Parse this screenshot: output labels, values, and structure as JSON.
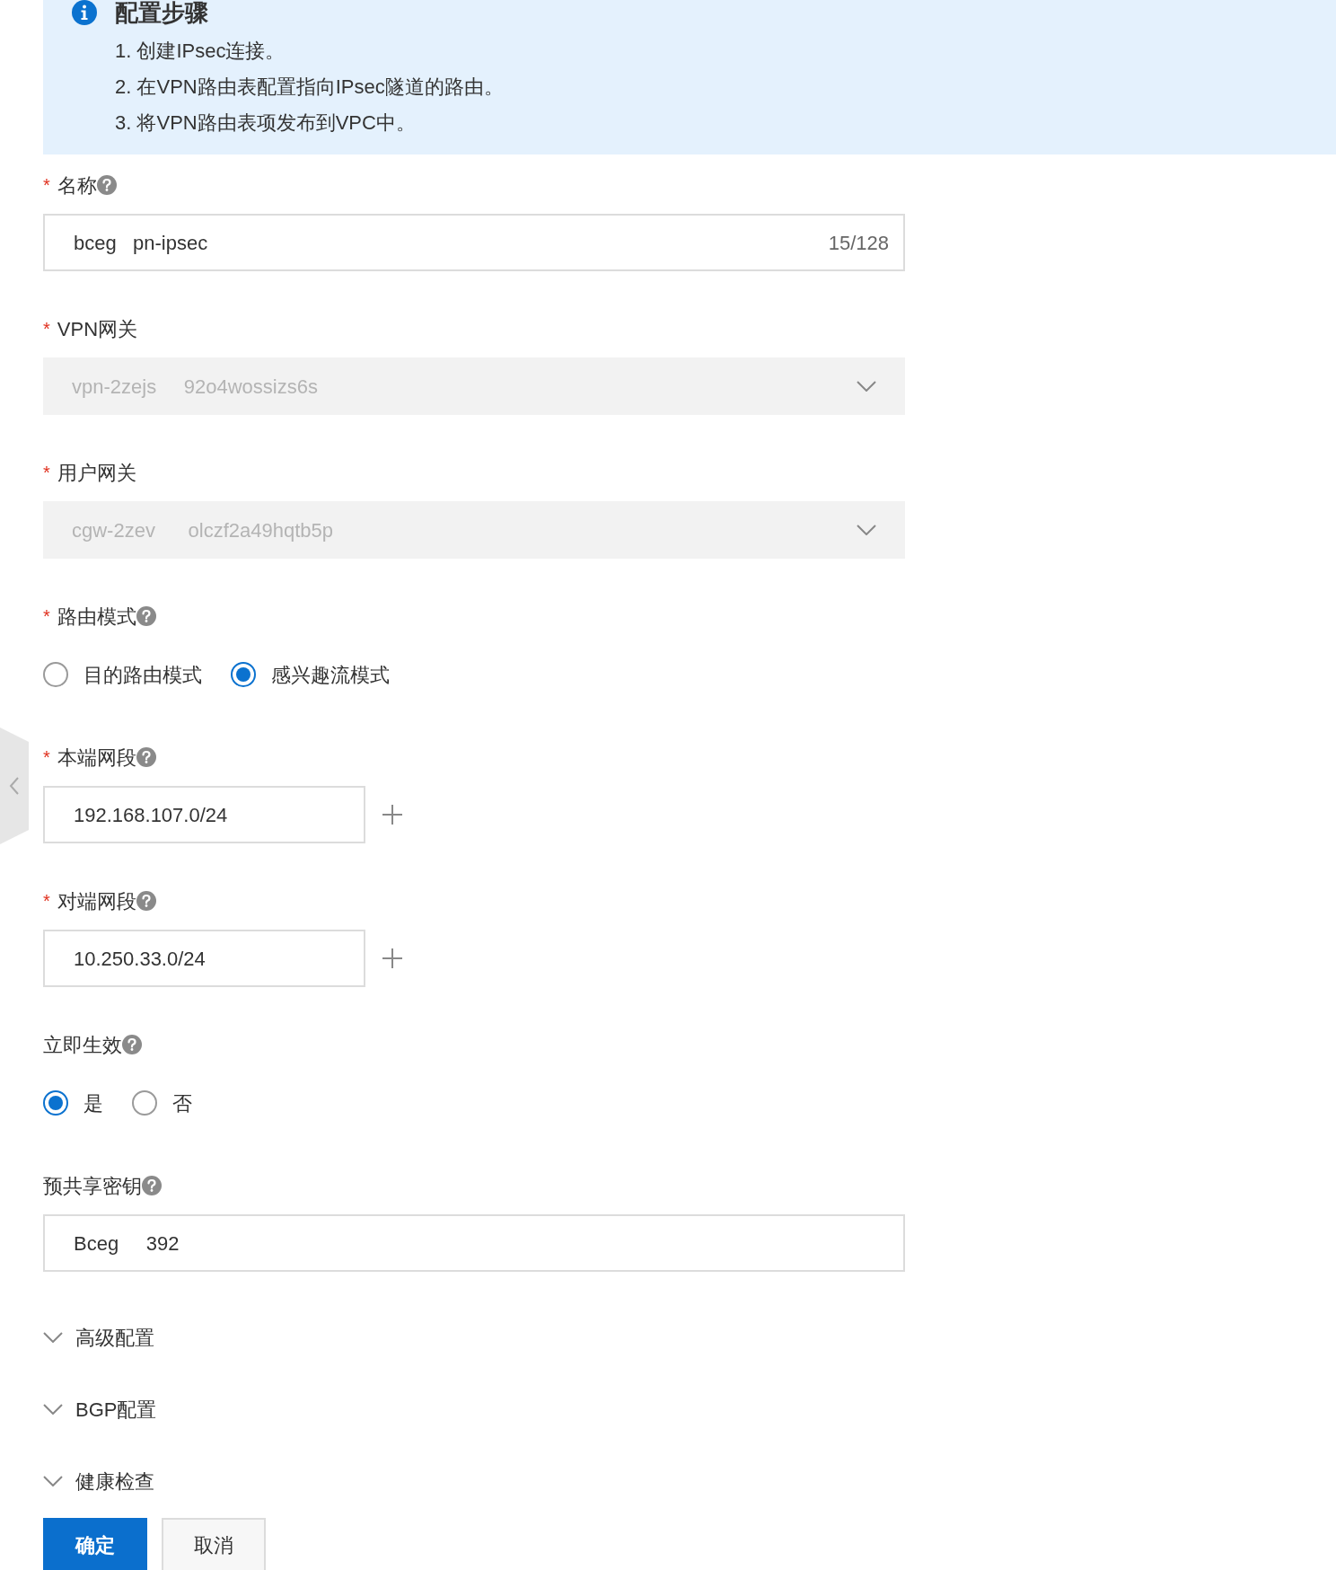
{
  "steps_panel": {
    "title": "配置步骤",
    "steps": [
      "1. 创建IPsec连接。",
      "2. 在VPN路由表配置指向IPsec隧道的路由。",
      "3. 将VPN路由表项发布到VPC中。"
    ]
  },
  "fields": [
    {
      "kind": "text",
      "label": "名称",
      "required_mark": "*",
      "help": true,
      "value": "bceg   pn-ipsec",
      "counter": "15/128"
    },
    {
      "kind": "select",
      "label": "VPN网关",
      "required_mark": "*",
      "help": false,
      "value": "vpn-2zejs     92o4wossizs6s",
      "disabled": true
    },
    {
      "kind": "select",
      "label": "用户网关",
      "required_mark": "*",
      "help": false,
      "value": "cgw-2zev      olczf2a49hqtb5p",
      "disabled": true
    },
    {
      "kind": "radio",
      "label": "路由模式",
      "required_mark": "*",
      "help": true,
      "options": [
        {
          "label": "目的路由模式",
          "selected": false
        },
        {
          "label": "感兴趣流模式",
          "selected": true
        }
      ]
    },
    {
      "kind": "cidr",
      "label": "本端网段",
      "required_mark": "*",
      "help": true,
      "value": "192.168.107.0/24"
    },
    {
      "kind": "cidr",
      "label": "对端网段",
      "required_mark": "*",
      "help": true,
      "value": "10.250.33.0/24"
    },
    {
      "kind": "radio",
      "label": "立即生效",
      "help": true,
      "options": [
        {
          "label": "是",
          "selected": true
        },
        {
          "label": "否",
          "selected": false
        }
      ]
    },
    {
      "kind": "text",
      "label": "预共享密钥",
      "help": true,
      "value": "Bceg     392"
    }
  ],
  "sections": [
    {
      "label": "高级配置"
    },
    {
      "label": "BGP配置"
    },
    {
      "label": "健康检查"
    }
  ],
  "buttons": [
    {
      "label": "确定",
      "kind": "primary"
    },
    {
      "label": "取消",
      "kind": "default"
    }
  ]
}
